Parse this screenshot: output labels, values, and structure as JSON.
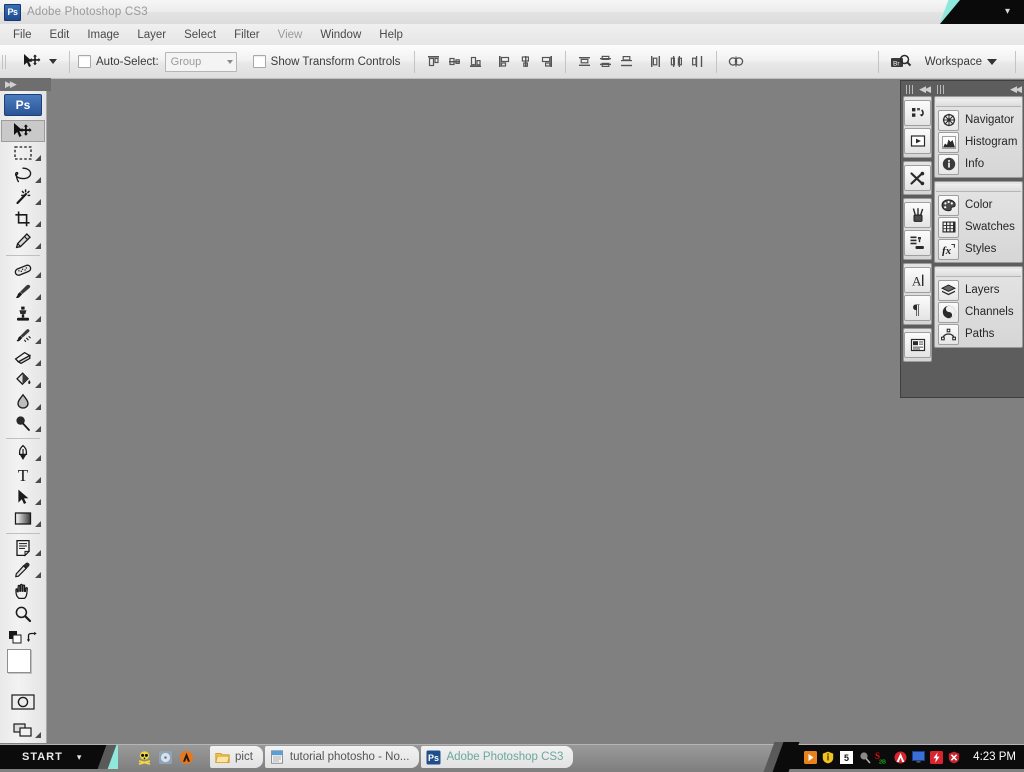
{
  "window": {
    "app_title": "Adobe Photoshop CS3",
    "app_badge": "Ps"
  },
  "menubar": {
    "items": [
      {
        "label": "File",
        "dim": false
      },
      {
        "label": "Edit",
        "dim": false
      },
      {
        "label": "Image",
        "dim": false
      },
      {
        "label": "Layer",
        "dim": false
      },
      {
        "label": "Select",
        "dim": false
      },
      {
        "label": "Filter",
        "dim": false
      },
      {
        "label": "View",
        "dim": true
      },
      {
        "label": "Window",
        "dim": false
      },
      {
        "label": "Help",
        "dim": false
      }
    ]
  },
  "options_bar": {
    "tool_icon": "move-tool-icon",
    "auto_select_label": "Auto-Select:",
    "auto_select_value": "Group",
    "auto_select_checked": false,
    "show_transform_label": "Show Transform Controls",
    "show_transform_checked": false,
    "align_buttons": [
      "align-top-edges",
      "align-vertical-centers",
      "align-bottom-edges",
      "align-left-edges",
      "align-horizontal-centers",
      "align-right-edges"
    ],
    "distribute_buttons": [
      "distribute-top-edges",
      "distribute-vertical-centers",
      "distribute-bottom-edges",
      "distribute-left-edges",
      "distribute-horizontal-centers",
      "distribute-right-edges"
    ],
    "auto_align_button": "auto-align-layers",
    "bridge_button": "go-to-bridge",
    "workspace_label": "Workspace"
  },
  "toolbox": {
    "tools": [
      {
        "name": "move-tool",
        "has_flyout": false,
        "active": true
      },
      {
        "name": "rectangular-marquee-tool",
        "has_flyout": true,
        "active": false
      },
      {
        "name": "lasso-tool",
        "has_flyout": true,
        "active": false
      },
      {
        "name": "magic-wand-tool",
        "has_flyout": true,
        "active": false
      },
      {
        "name": "crop-tool",
        "has_flyout": true,
        "active": false
      },
      {
        "name": "slice-tool",
        "has_flyout": true,
        "active": false
      },
      {
        "name": "healing-brush-tool",
        "has_flyout": true,
        "active": false
      },
      {
        "name": "brush-tool",
        "has_flyout": true,
        "active": false
      },
      {
        "name": "clone-stamp-tool",
        "has_flyout": true,
        "active": false
      },
      {
        "name": "history-brush-tool",
        "has_flyout": true,
        "active": false
      },
      {
        "name": "eraser-tool",
        "has_flyout": true,
        "active": false
      },
      {
        "name": "paint-bucket-tool",
        "has_flyout": true,
        "active": false
      },
      {
        "name": "blur-tool",
        "has_flyout": true,
        "active": false
      },
      {
        "name": "dodge-tool",
        "has_flyout": true,
        "active": false
      },
      {
        "name": "pen-tool",
        "has_flyout": true,
        "active": false
      },
      {
        "name": "horizontal-type-tool",
        "has_flyout": true,
        "active": false
      },
      {
        "name": "path-selection-tool",
        "has_flyout": true,
        "active": false
      },
      {
        "name": "gradient-tool",
        "has_flyout": true,
        "active": false
      },
      {
        "name": "notes-tool",
        "has_flyout": true,
        "active": false
      },
      {
        "name": "eyedropper-tool",
        "has_flyout": true,
        "active": false
      },
      {
        "name": "hand-tool",
        "has_flyout": false,
        "active": false
      },
      {
        "name": "zoom-tool",
        "has_flyout": false,
        "active": false
      }
    ],
    "foreground_color": "#ffffff",
    "background_color": "#12303c",
    "quick_mask_button": "edit-in-quick-mask-mode",
    "screen_mode_button": "change-screen-mode"
  },
  "dock": {
    "icon_column": [
      "history-panel-icon",
      "actions-panel-icon",
      "tool-presets-panel-icon",
      "brushes-panel-icon",
      "clone-source-panel-icon",
      "character-panel-icon",
      "paragraph-panel-icon",
      "layer-comps-panel-icon"
    ],
    "groups": [
      {
        "panels": [
          {
            "label": "Navigator",
            "icon": "navigator-icon"
          },
          {
            "label": "Histogram",
            "icon": "histogram-icon"
          },
          {
            "label": "Info",
            "icon": "info-icon"
          }
        ]
      },
      {
        "panels": [
          {
            "label": "Color",
            "icon": "color-icon"
          },
          {
            "label": "Swatches",
            "icon": "swatches-icon"
          },
          {
            "label": "Styles",
            "icon": "styles-icon"
          }
        ]
      },
      {
        "panels": [
          {
            "label": "Layers",
            "icon": "layers-icon"
          },
          {
            "label": "Channels",
            "icon": "channels-icon"
          },
          {
            "label": "Paths",
            "icon": "paths-icon"
          }
        ]
      }
    ]
  },
  "canvas": {
    "background_color": "#808080"
  },
  "taskbar": {
    "start_label": "START",
    "quick_launch": [
      "skull-icon",
      "cd-icon",
      "amule-icon"
    ],
    "tasks": [
      {
        "label": "pict",
        "icon": "folder-icon",
        "active": false
      },
      {
        "label": "tutorial photosho - No...",
        "icon": "notepad-icon",
        "active": false
      },
      {
        "label": "Adobe Photoshop CS3",
        "icon": "photoshop-icon",
        "active": true
      }
    ],
    "tray_icons": [
      "media-player-icon",
      "shield-icon",
      "five-icon",
      "pencil-icon",
      "s2b-icon",
      "avira-icon",
      "monitor-icon",
      "lightning-icon",
      "antivirus-icon"
    ],
    "clock": "4:23 PM"
  }
}
